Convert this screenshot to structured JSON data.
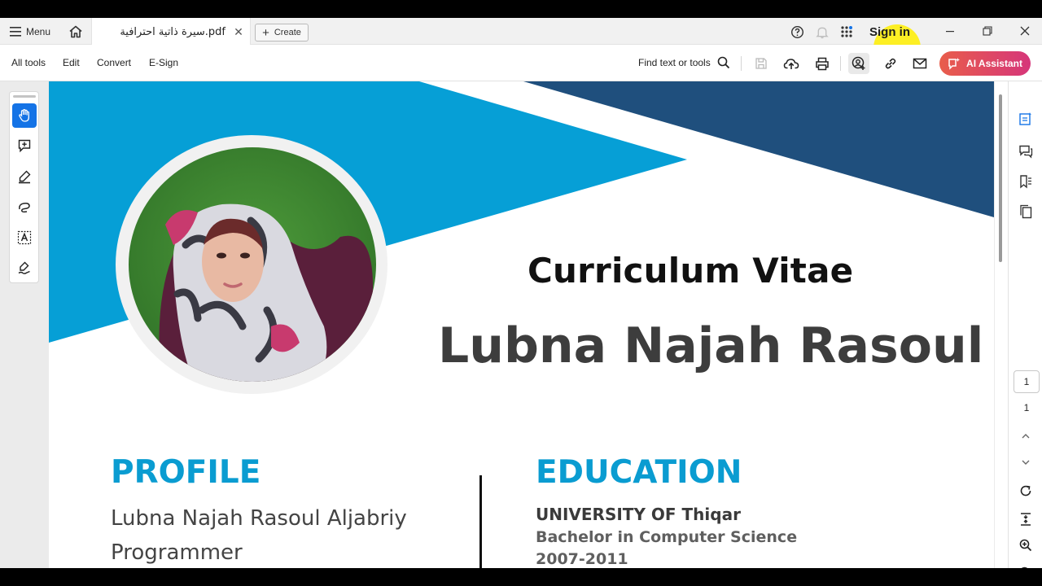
{
  "titlebar": {
    "menu_label": "Menu",
    "tab_title": "سيرة ذاتية احترافية.pdf",
    "create_label": "Create",
    "sign_in_label": "Sign in"
  },
  "toolbar": {
    "all_tools": "All tools",
    "edit": "Edit",
    "convert": "Convert",
    "esign": "E-Sign",
    "find_placeholder": "Find text or tools",
    "ai_assistant": "AI Assistant"
  },
  "document": {
    "cv_title": "Curriculum Vitae",
    "name": "Lubna Najah Rasoul",
    "profile": {
      "heading": "PROFILE",
      "full_name": "Lubna Najah Rasoul Aljabriy",
      "role": "Programmer"
    },
    "education": {
      "heading": "EDUCATION",
      "university": "UNIVERSITY OF Thiqar",
      "degree": "Bachelor in Computer Science",
      "years": "2007-2011"
    }
  },
  "page_nav": {
    "current_page": "1",
    "total_pages": "1"
  },
  "colors": {
    "light_blue": "#069fd6",
    "dark_blue": "#1f4f7d",
    "heading_blue": "#0a9cd1",
    "ai_gradient_start": "#e85d4b",
    "ai_gradient_end": "#d6367a",
    "selected_tool": "#1473e6"
  }
}
